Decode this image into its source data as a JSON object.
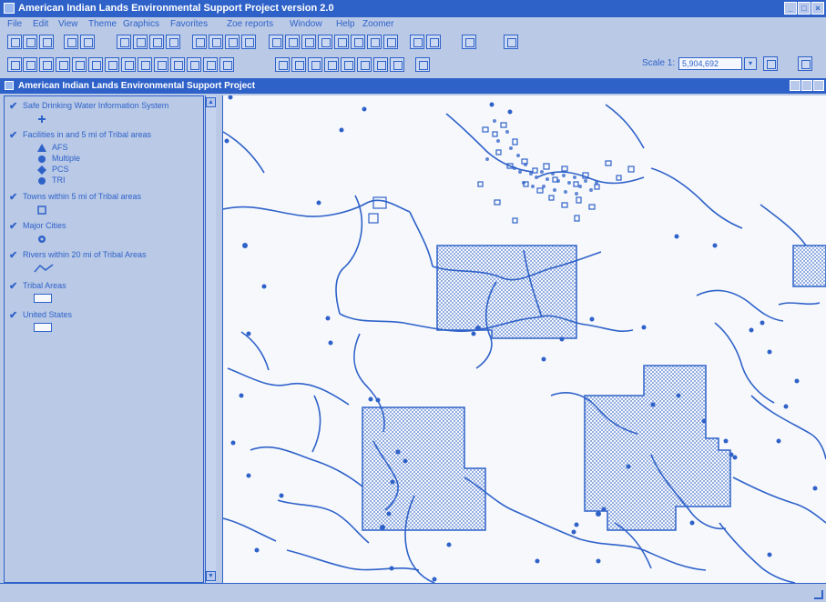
{
  "window": {
    "title": "American Indian Lands Environmental Support Project version 2.0",
    "buttons": [
      "_",
      "□",
      "×"
    ]
  },
  "menu": [
    "File",
    "Edit",
    "View",
    "Theme",
    "Graphics",
    "Favorites",
    "Zoe reports",
    "Window",
    "Help",
    "Zoomer"
  ],
  "toolbar": {
    "scale_label": "Scale 1:",
    "scale_value": "5,904,692",
    "dropdown_glyph": "▾"
  },
  "document": {
    "title": "American Indian Lands Environmental Support Project"
  },
  "toc": {
    "layers": [
      {
        "name": "Safe Drinking Water Information System",
        "legend": []
      },
      {
        "name": "Facilities in and 5 mi of Tribal areas",
        "legend": [
          "AFS",
          "Multiple",
          "PCS",
          "TRI"
        ]
      },
      {
        "name": "Towns within 5 mi of Tribal areas",
        "legend": []
      },
      {
        "name": "Major Cities",
        "legend": []
      },
      {
        "name": "Rivers within 20 mi of Tribal Areas",
        "legend": []
      },
      {
        "name": "Tribal Areas",
        "legend": []
      },
      {
        "name": "United States",
        "legend": []
      }
    ]
  },
  "scroll": {
    "up": "▲",
    "down": "▼"
  },
  "colors": {
    "accent": "#2f62c9",
    "panel": "#b9c9e6",
    "map_background": "#f6f8fc",
    "feature": "#2f62c9"
  }
}
